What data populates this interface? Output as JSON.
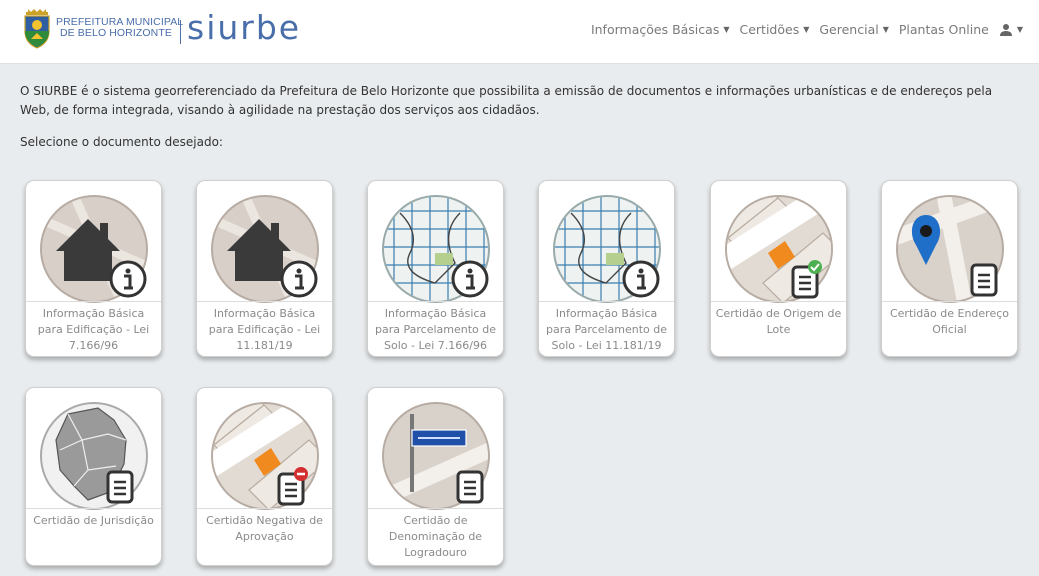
{
  "header": {
    "pref_line1": "PREFEITURA MUNICIPAL",
    "pref_line2": "DE BELO HORIZONTE",
    "brand": "siurbe",
    "nav": [
      {
        "label": "Informações Básicas",
        "icon": "caret-down-icon"
      },
      {
        "label": "Certidões",
        "icon": "caret-down-icon"
      },
      {
        "label": "Gerencial",
        "icon": "caret-down-icon"
      },
      {
        "label": "Plantas Online",
        "icon": ""
      }
    ],
    "user_icon": "user-icon",
    "caret": "▼"
  },
  "intro": "O SIURBE é o sistema georreferenciado da Prefeitura de Belo Horizonte que possibilita a emissão de documentos e informações urbanísticas e de endereços pela Web, de forma integrada, visando à agilidade na prestação dos serviços aos cidadãos.",
  "prompt": "Selecione o documento desejado:",
  "cards": [
    {
      "label": "Informação Básica para Edificação - Lei 7.166/96",
      "icon": "house-info-icon"
    },
    {
      "label": "Informação Básica para Edificação - Lei 11.181/19",
      "icon": "house-info-icon"
    },
    {
      "label": "Informação Básica para Parcelamento de Solo - Lei 7.166/96",
      "icon": "map-grid-info-icon"
    },
    {
      "label": "Informação Básica para Parcelamento de Solo - Lei 11.181/19",
      "icon": "map-grid-info-icon"
    },
    {
      "label": "Certidão de Origem de Lote",
      "icon": "lot-certificate-check-icon"
    },
    {
      "label": "Certidão de Endereço Oficial",
      "icon": "map-pin-document-icon"
    },
    {
      "label": "Certidão de Jurisdição",
      "icon": "city-map-document-icon"
    },
    {
      "label": "Certidão Negativa de Aprovação",
      "icon": "lot-certificate-denied-icon"
    },
    {
      "label": "Certidão de Denominação de Logradouro",
      "icon": "street-sign-document-icon"
    }
  ],
  "colors": {
    "brand": "#4a6ea9",
    "background": "#e9ecee",
    "lot_orange": "#f08a1e",
    "check_green": "#4caf50",
    "deny_red": "#d32f2f"
  }
}
